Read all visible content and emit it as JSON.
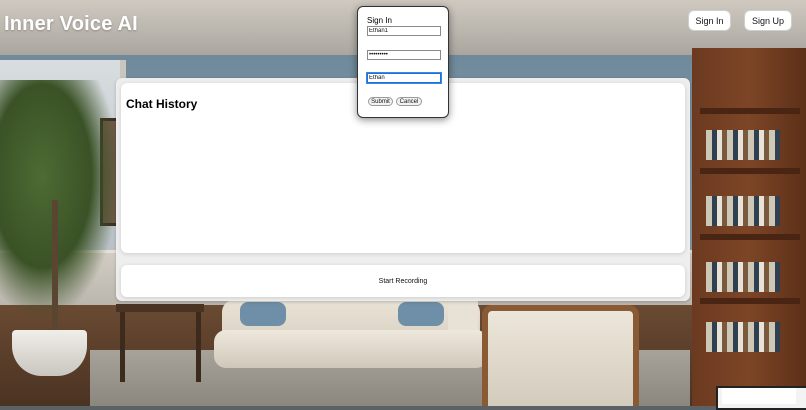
{
  "header": {
    "app_title": "Inner Voice AI",
    "sign_in_label": "Sign In",
    "sign_up_label": "Sign Up"
  },
  "main": {
    "chat_history_title": "Chat History",
    "start_recording_label": "Start Recording"
  },
  "sign_in_dialog": {
    "title": "Sign In",
    "username_value": "Ethan1",
    "password_value": "•••••••••",
    "name_value": "Ethan",
    "submit_label": "Submit",
    "cancel_label": "Cancel"
  },
  "colors": {
    "focus_border": "#1f6fd8",
    "panel_background": "#eeeeee",
    "card_background": "#ffffff"
  }
}
